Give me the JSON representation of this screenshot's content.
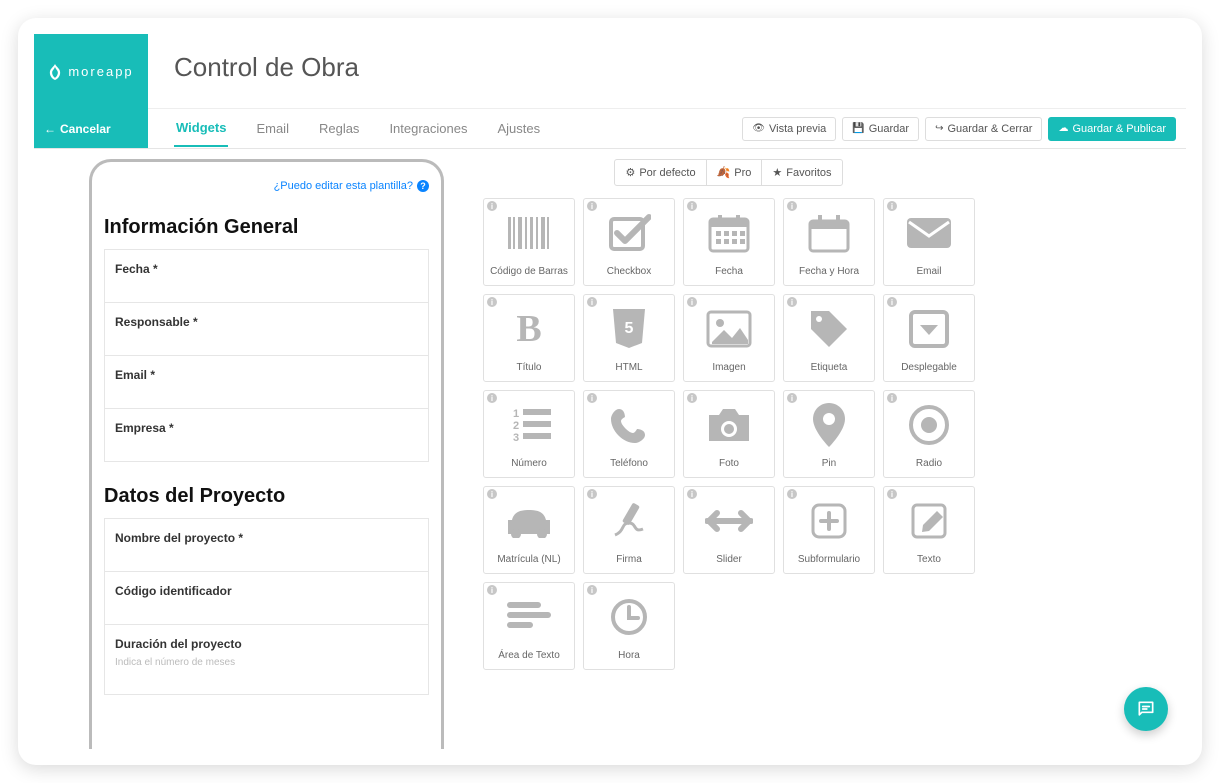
{
  "app": {
    "brand": "moreapp",
    "title": "Control de Obra"
  },
  "cancel_label": "Cancelar",
  "tabs": {
    "items": [
      "Widgets",
      "Email",
      "Reglas",
      "Integraciones",
      "Ajustes"
    ],
    "active_index": 0
  },
  "actions": {
    "preview": "Vista previa",
    "save": "Guardar",
    "save_close": "Guardar & Cerrar",
    "save_publish": "Guardar & Publicar"
  },
  "preview": {
    "edit_link": "¿Puedo editar esta plantilla?",
    "sections": [
      {
        "title": "Información General",
        "fields": [
          {
            "label": "Fecha *"
          },
          {
            "label": "Responsable *"
          },
          {
            "label": "Email *"
          },
          {
            "label": "Empresa *"
          }
        ]
      },
      {
        "title": "Datos del Proyecto",
        "fields": [
          {
            "label": "Nombre del proyecto *"
          },
          {
            "label": "Código identificador"
          },
          {
            "label": "Duración del proyecto",
            "hint": "Indica el número de meses"
          }
        ]
      }
    ]
  },
  "widget_tabs": {
    "default": "Por defecto",
    "pro": "Pro",
    "favorites": "Favoritos"
  },
  "widgets": [
    {
      "name": "barcode",
      "label": "Código de Barras"
    },
    {
      "name": "checkbox",
      "label": "Checkbox"
    },
    {
      "name": "date",
      "label": "Fecha"
    },
    {
      "name": "datetime",
      "label": "Fecha y Hora"
    },
    {
      "name": "email",
      "label": "Email"
    },
    {
      "name": "title",
      "label": "Título"
    },
    {
      "name": "html",
      "label": "HTML"
    },
    {
      "name": "image",
      "label": "Imagen"
    },
    {
      "name": "tag",
      "label": "Etiqueta"
    },
    {
      "name": "dropdown",
      "label": "Desplegable"
    },
    {
      "name": "number",
      "label": "Número"
    },
    {
      "name": "phone",
      "label": "Teléfono"
    },
    {
      "name": "photo",
      "label": "Foto"
    },
    {
      "name": "pin",
      "label": "Pin"
    },
    {
      "name": "radio",
      "label": "Radio"
    },
    {
      "name": "plate",
      "label": "Matrícula (NL)"
    },
    {
      "name": "signature",
      "label": "Firma"
    },
    {
      "name": "slider",
      "label": "Slider"
    },
    {
      "name": "subform",
      "label": "Subformulario"
    },
    {
      "name": "text",
      "label": "Texto"
    },
    {
      "name": "textarea",
      "label": "Área de Texto"
    },
    {
      "name": "time",
      "label": "Hora"
    }
  ]
}
